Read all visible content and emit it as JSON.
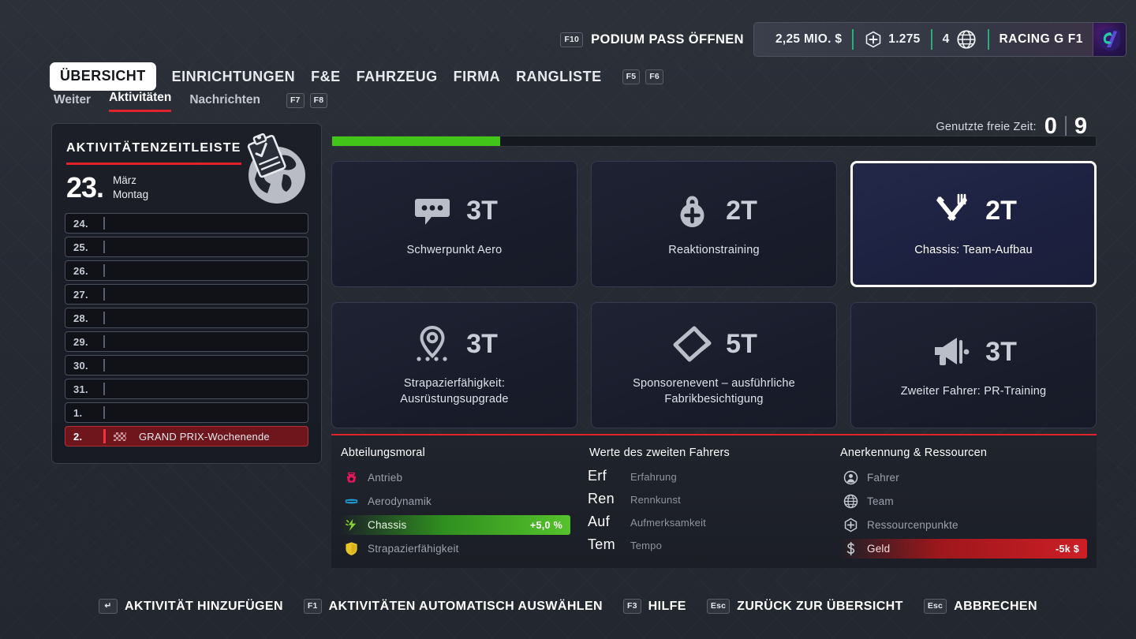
{
  "topbar": {
    "podium_key": "F10",
    "podium_label": "PODIUM PASS ÖFFNEN",
    "money": "2,25 MIO. $",
    "resource_points": "1.275",
    "reputation": "4",
    "team_name": "RACING G F1",
    "icons": {
      "resource": "hexagon-plus-icon",
      "reputation": "globe-icon",
      "logo": "team-logo-icon"
    }
  },
  "nav": {
    "main_tabs": [
      {
        "label": "ÜBERSICHT",
        "active": true
      },
      {
        "label": "EINRICHTUNGEN",
        "active": false
      },
      {
        "label": "F&E",
        "active": false
      },
      {
        "label": "FAHRZEUG",
        "active": false
      },
      {
        "label": "FIRMA",
        "active": false
      },
      {
        "label": "RANGLISTE",
        "active": false
      }
    ],
    "main_keys": [
      "F5",
      "F6"
    ],
    "sub_tabs": [
      {
        "label": "Weiter",
        "active": false
      },
      {
        "label": "Aktivitäten",
        "active": true
      },
      {
        "label": "Nachrichten",
        "active": false
      }
    ],
    "sub_keys": [
      "F7",
      "F8"
    ]
  },
  "freetime": {
    "label": "Genutzte freie Zeit:",
    "used": "0",
    "total": "9"
  },
  "timeline": {
    "title": "AKTIVITÄTENZEITLEISTE",
    "current_day": "23.",
    "current_month": "März",
    "current_weekday": "Montag",
    "globe_icon": "globe-clipboard-icon",
    "rows": [
      {
        "num": "24.",
        "text": "",
        "type": "empty"
      },
      {
        "num": "25.",
        "text": "",
        "type": "empty"
      },
      {
        "num": "26.",
        "text": "",
        "type": "empty"
      },
      {
        "num": "27.",
        "text": "",
        "type": "empty"
      },
      {
        "num": "28.",
        "text": "",
        "type": "empty"
      },
      {
        "num": "29.",
        "text": "",
        "type": "empty"
      },
      {
        "num": "30.",
        "text": "",
        "type": "empty"
      },
      {
        "num": "31.",
        "text": "",
        "type": "empty"
      },
      {
        "num": "1.",
        "text": "",
        "type": "empty"
      },
      {
        "num": "2.",
        "text": "GRAND PRIX-Wochenende",
        "type": "gp"
      }
    ]
  },
  "progress": {
    "percent": 22
  },
  "cards": [
    {
      "days": "3T",
      "label": "Schwerpunkt Aero",
      "icon": "speech-bubble-icon",
      "selected": false
    },
    {
      "days": "2T",
      "label": "Reaktionstraining",
      "icon": "weight-plus-icon",
      "selected": false
    },
    {
      "days": "2T",
      "label": "Chassis: Team-Aufbau",
      "icon": "cutlery-icon",
      "selected": true
    },
    {
      "days": "3T",
      "label": "Strapazierfähigkeit:\nAusrüstungsupgrade",
      "icon": "location-pin-icon",
      "selected": false
    },
    {
      "days": "5T",
      "label": "Sponsorenevent – ausführliche\nFabrikbesichtigung",
      "icon": "rotate-box-icon",
      "selected": false
    },
    {
      "days": "3T",
      "label": "Zweiter Fahrer: PR-Training",
      "icon": "megaphone-icon",
      "selected": false
    }
  ],
  "stats": {
    "morale": {
      "heading": "Abteilungsmoral",
      "rows": [
        {
          "name": "Antrieb",
          "value": "",
          "state": "none",
          "icon": "engine-icon",
          "color": "#e8175a"
        },
        {
          "name": "Aerodynamik",
          "value": "",
          "state": "none",
          "icon": "wing-icon",
          "color": "#1ea3dd"
        },
        {
          "name": "Chassis",
          "value": "+5,0 %",
          "state": "pos",
          "icon": "chassis-icon",
          "color": "#8bd62f"
        },
        {
          "name": "Strapazierfähigkeit",
          "value": "",
          "state": "none",
          "icon": "shield-icon",
          "color": "#e8c427"
        }
      ]
    },
    "driver": {
      "heading": "Werte des zweiten Fahrers",
      "rows": [
        {
          "abbr": "Erf",
          "name": "Erfahrung"
        },
        {
          "abbr": "Ren",
          "name": "Rennkunst"
        },
        {
          "abbr": "Auf",
          "name": "Aufmerksamkeit"
        },
        {
          "abbr": "Tem",
          "name": "Tempo"
        }
      ]
    },
    "resources": {
      "heading": "Anerkennung & Ressourcen",
      "rows": [
        {
          "name": "Fahrer",
          "value": "",
          "state": "none",
          "icon": "person-circle-icon"
        },
        {
          "name": "Team",
          "value": "",
          "state": "none",
          "icon": "globe-circle-icon"
        },
        {
          "name": "Ressourcenpunkte",
          "value": "",
          "state": "none",
          "icon": "hexagon-plus-icon"
        },
        {
          "name": "Geld",
          "value": "-5k $",
          "state": "neg",
          "icon": "dollar-icon"
        }
      ]
    }
  },
  "actions": [
    {
      "key": "↵",
      "label": "AKTIVITÄT HINZUFÜGEN"
    },
    {
      "key": "F1",
      "label": "AKTIVITÄTEN AUTOMATISCH AUSWÄHLEN"
    },
    {
      "key": "F3",
      "label": "HILFE"
    },
    {
      "key": "Esc",
      "label": "ZURÜCK ZUR ÜBERSICHT"
    },
    {
      "key": "Esc",
      "label": "ABBRECHEN"
    }
  ],
  "colors": {
    "accent_red": "#e2222b",
    "progress_green": "#43c418",
    "positive_green": "#56c22c",
    "negative_red": "#cc1f26"
  }
}
